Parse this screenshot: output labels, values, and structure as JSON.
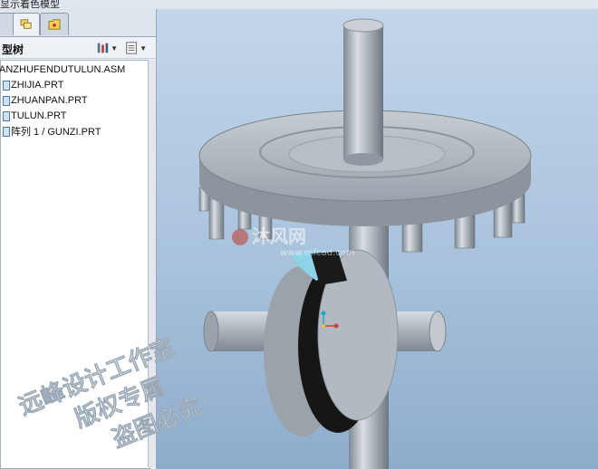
{
  "window": {
    "caption": "显示着色模型"
  },
  "navigator": {
    "tabs": [
      {
        "icon": "model-tree-icon"
      },
      {
        "icon": "layers-icon"
      },
      {
        "icon": "favorites-folder-icon"
      }
    ],
    "panel_title": "型树",
    "toolbar": {
      "settings_icon": "tree-settings-icon",
      "show_icon": "tree-show-icon"
    },
    "tree_items": [
      {
        "label": "ANZHUFENDUTULUN.ASM",
        "icon": "assembly-icon"
      },
      {
        "label": "ZHIJIA.PRT",
        "icon": "part-icon"
      },
      {
        "label": "ZHUANPAN.PRT",
        "icon": "part-icon"
      },
      {
        "label": "TULUN.PRT",
        "icon": "part-icon"
      },
      {
        "label": "阵列 1 / GUNZI.PRT",
        "icon": "pattern-icon"
      }
    ]
  },
  "watermark": {
    "site_name": "沐风网",
    "site_url": "www.mfcad.com",
    "stamp_lines": [
      "远峰设计工作室",
      "版权专属",
      "盗图必究"
    ]
  },
  "colors": {
    "viewport_top": "#c2d6ea",
    "viewport_bottom": "#8eaccc",
    "part_gray": "#aab2ba",
    "cam_dark": "#151515",
    "highlight": "#8fd3e8"
  }
}
